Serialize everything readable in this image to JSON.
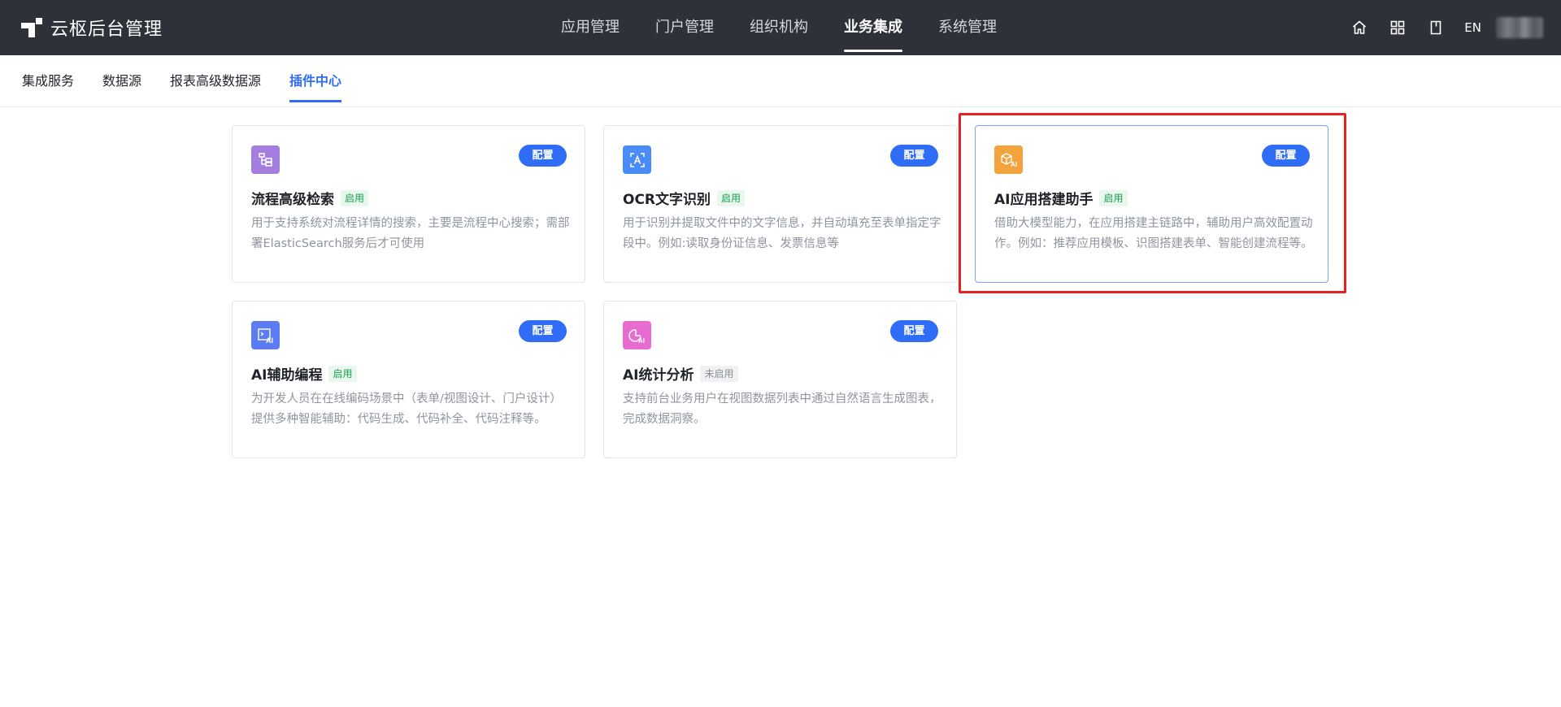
{
  "header": {
    "app_title": "云枢后台管理",
    "nav": [
      {
        "label": "应用管理"
      },
      {
        "label": "门户管理"
      },
      {
        "label": "组织机构"
      },
      {
        "label": "业务集成"
      },
      {
        "label": "系统管理"
      }
    ],
    "active_nav": "业务集成",
    "lang_label": "EN",
    "icons": [
      "home-icon",
      "apps-grid-icon",
      "document-icon"
    ]
  },
  "subtabs": [
    {
      "label": "集成服务"
    },
    {
      "label": "数据源"
    },
    {
      "label": "报表高级数据源"
    },
    {
      "label": "插件中心"
    }
  ],
  "active_subtab": "插件中心",
  "plugins": [
    {
      "title": "流程高级检索",
      "status": "启用",
      "enabled": true,
      "button": "配置",
      "icon": "flow-tree-icon",
      "icon_color": "#a47de0",
      "description": "用于支持系统对流程详情的搜索，主要是流程中心搜索；需部署ElasticSearch服务后才可使用"
    },
    {
      "title": "OCR文字识别",
      "status": "启用",
      "enabled": true,
      "button": "配置",
      "icon": "ocr-scan-icon",
      "icon_color": "#4a8cf7",
      "description": "用于识别并提取文件中的文字信息，并自动填充至表单指定字段中。例如:读取身份证信息、发票信息等"
    },
    {
      "title": "AI应用搭建助手",
      "status": "启用",
      "enabled": true,
      "button": "配置",
      "icon": "ai-cube-icon",
      "icon_color": "#f2a33c",
      "description": "借助大模型能力，在应用搭建主链路中，辅助用户高效配置动作。例如：推荐应用模板、识图搭建表单、智能创建流程等。"
    },
    {
      "title": "AI辅助编程",
      "status": "启用",
      "enabled": true,
      "button": "配置",
      "icon": "ai-code-icon",
      "icon_color": "#5b7cf2",
      "description": "为开发人员在在线编码场景中（表单/视图设计、门户设计）提供多种智能辅助：代码生成、代码补全、代码注释等。"
    },
    {
      "title": "AI统计分析",
      "status": "未启用",
      "enabled": false,
      "button": "配置",
      "icon": "ai-chart-icon",
      "icon_color": "#e86ccf",
      "description": "支持前台业务用户在视图数据列表中通过自然语言生成图表，完成数据洞察。"
    }
  ],
  "colors": {
    "accent": "#2f6df6",
    "topbar": "#2e3138",
    "enabled_green": "#16a34a",
    "highlight": "#e82020"
  }
}
